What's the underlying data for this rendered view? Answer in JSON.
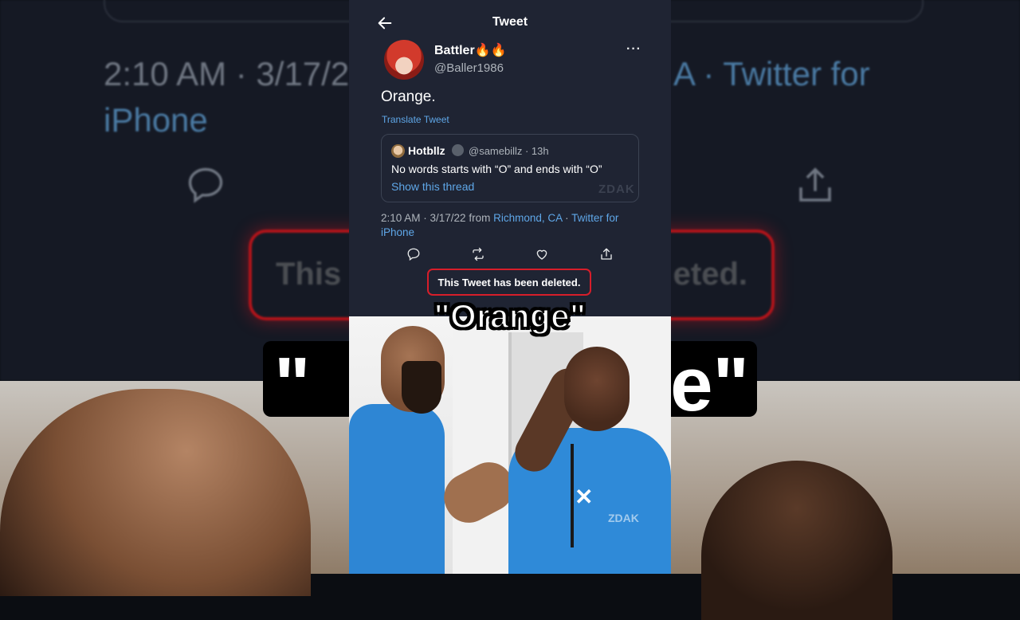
{
  "header": {
    "title": "Tweet"
  },
  "tweet": {
    "display_name": "Battler🔥🔥",
    "handle": "@Baller1986",
    "text": "Orange.",
    "translate_label": "Translate Tweet",
    "quote": {
      "name": "Hotbllz",
      "handle_time": "@samebillz · 13h",
      "text": "No words starts with “O” and ends with “O”",
      "show_thread": "Show this thread",
      "watermark": "ZDAK"
    },
    "meta": {
      "time_date": "2:10 AM · 3/17/22 from ",
      "location": "Richmond, CA",
      "separator": " · ",
      "client": "Twitter for iPhone"
    },
    "deleted_notice": "This Tweet has been deleted."
  },
  "icons": [
    "back-arrow-icon",
    "more-icon",
    "reply-icon",
    "retweet-icon",
    "like-icon",
    "share-icon"
  ],
  "background_ghost": {
    "time_text": "2:10 AM · 3/17/2",
    "time_tail": "A · Twitter for",
    "iphone": "iPhone",
    "deleted_left": "This",
    "deleted_right": "eted.",
    "quote_left": "\"",
    "quote_right": "e\""
  },
  "caption": "\"Orange\"",
  "video": {
    "watermark": "ZDAK"
  },
  "colors": {
    "panel": "#1f2433",
    "link": "#5fa7e8",
    "deleted_border": "#d71e2a",
    "shirt": "#2e86d4"
  }
}
